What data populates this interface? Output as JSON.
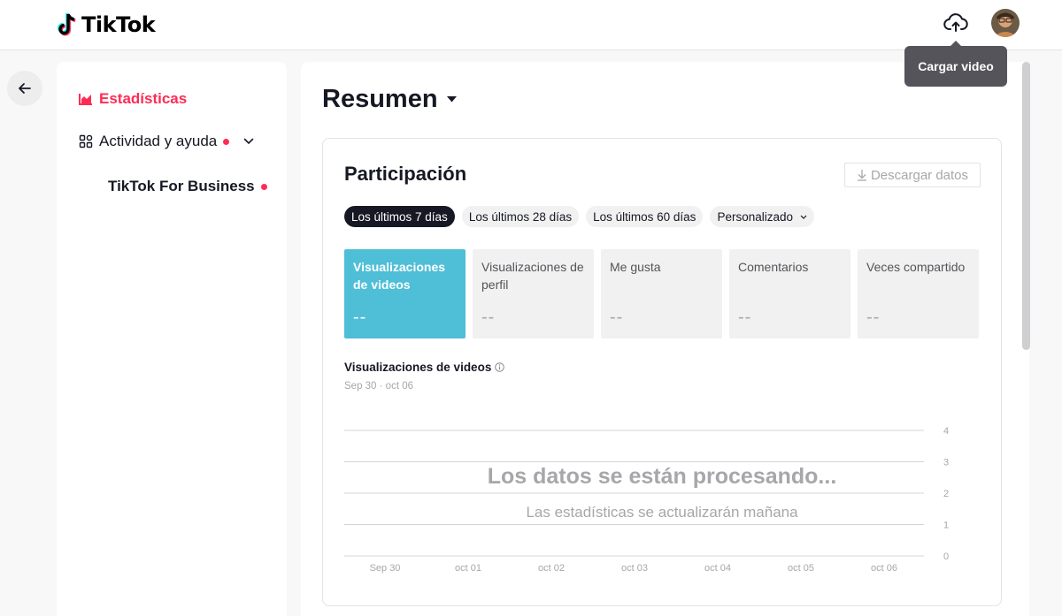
{
  "header": {
    "logo_text": "TikTok",
    "upload_tooltip": "Cargar video"
  },
  "sidebar": {
    "items": [
      {
        "label": "Estadísticas",
        "active": true
      },
      {
        "label": "Actividad y ayuda",
        "has_dot": true
      },
      {
        "label": "TikTok For Business",
        "has_dot": true
      }
    ]
  },
  "main": {
    "title": "Resumen",
    "card": {
      "title": "Participación",
      "download_label": "Descargar datos",
      "filters": [
        {
          "label": "Los últimos 7 días",
          "active": true
        },
        {
          "label": "Los últimos 28 días"
        },
        {
          "label": "Los últimos 60 días"
        },
        {
          "label": "Personalizado"
        }
      ],
      "metrics": [
        {
          "label": "Visualizaciones de videos",
          "value": "--",
          "active": true
        },
        {
          "label": "Visualizaciones de perfil",
          "value": "--"
        },
        {
          "label": "Me gusta",
          "value": "--"
        },
        {
          "label": "Comentarios",
          "value": "--"
        },
        {
          "label": "Veces compartido",
          "value": "--"
        }
      ],
      "chart_title": "Visualizaciones de videos",
      "chart_range": "Sep 30 · oct 06",
      "processing_title": "Los datos se están procesando...",
      "processing_subtitle": "Las estadísticas se actualizarán mañana"
    }
  },
  "colors": {
    "accent": "#fe2c55",
    "metric_active": "#4fbed7",
    "dark": "#161823"
  },
  "chart_data": {
    "type": "line",
    "title": "Visualizaciones de videos",
    "subtitle": "Sep 30 · oct 06",
    "categories": [
      "Sep 30",
      "oct 01",
      "oct 02",
      "oct 03",
      "oct 04",
      "oct 05",
      "oct 06"
    ],
    "series": [],
    "yticks": [
      "4",
      "3",
      "2",
      "1",
      "0"
    ],
    "ylim": [
      0,
      4
    ],
    "grid": true,
    "annotations": [
      "Los datos se están procesando...",
      "Las estadísticas se actualizarán mañana"
    ]
  }
}
